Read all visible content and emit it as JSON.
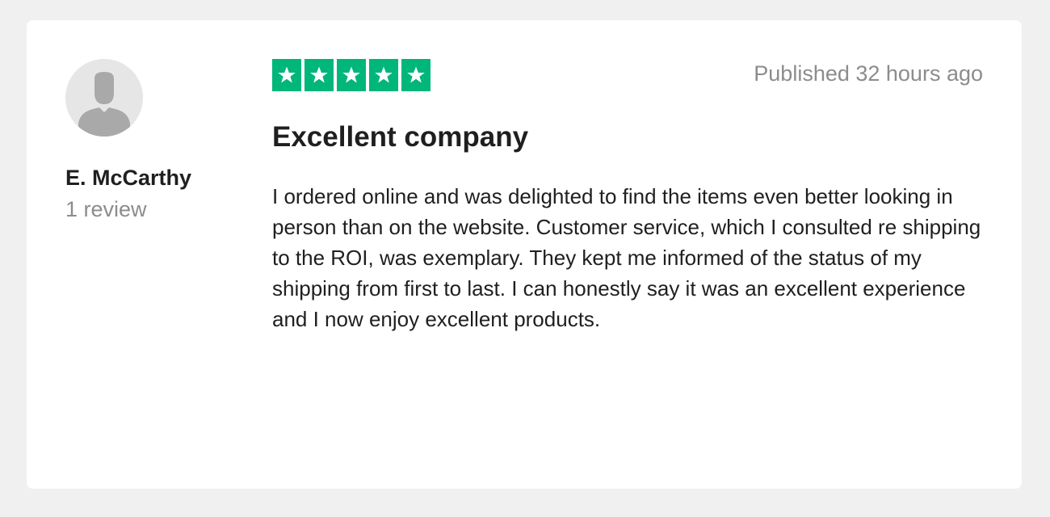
{
  "reviewer": {
    "avatar_icon": "person-silhouette-icon",
    "name": "E. McCarthy",
    "review_count": "1 review"
  },
  "rating": {
    "stars": 5,
    "max_stars": 5,
    "star_icon": "star-icon",
    "color": "#00b67a"
  },
  "review": {
    "published": "Published 32 hours ago",
    "title": "Excellent company",
    "body": "I ordered online and was delighted to find the items even better looking in person than on the website. Customer service, which I consulted re shipping to the ROI, was exemplary. They kept me informed of the status of my shipping from first to last. I can honestly say it was an excellent experience and I now enjoy excellent products."
  }
}
